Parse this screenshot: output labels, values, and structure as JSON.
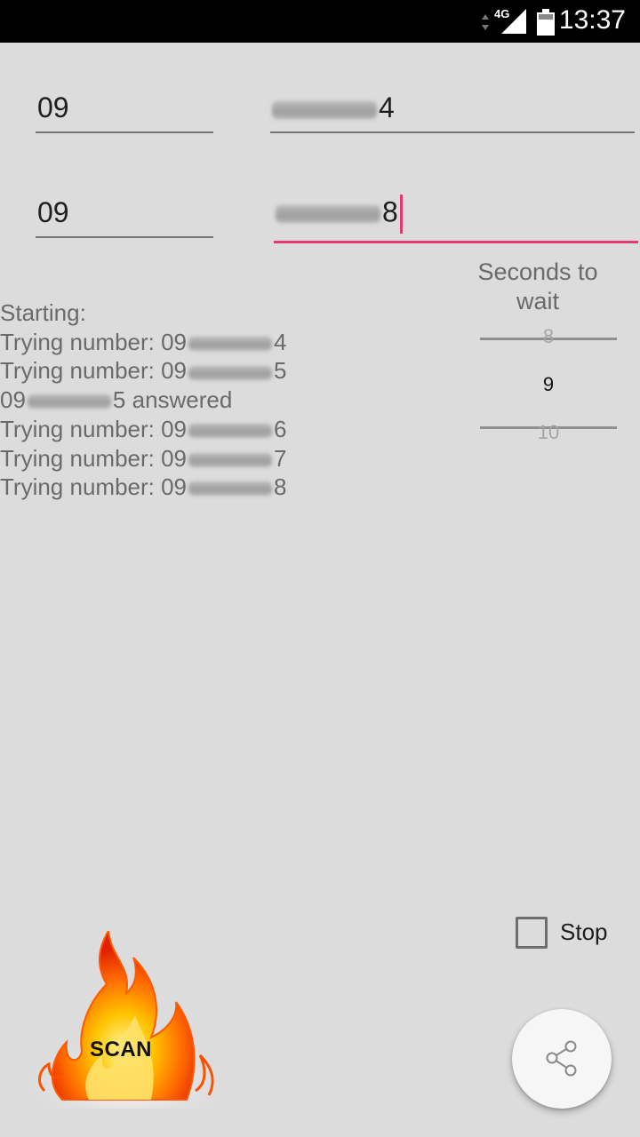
{
  "status_bar": {
    "network": "4G",
    "time": "13:37"
  },
  "form": {
    "prefix_start": "09",
    "number_start_suffix": "4",
    "prefix_end": "09",
    "number_end_suffix": "8"
  },
  "log": {
    "lines": [
      {
        "text": "Starting:",
        "redacted": false
      },
      {
        "before": "Trying number: 09",
        "after": "4",
        "redacted": true
      },
      {
        "before": "Trying number: 09",
        "after": "5",
        "redacted": true
      },
      {
        "before": "09",
        "after": "5 answered",
        "redacted": true
      },
      {
        "before": "Trying number: 09",
        "after": "6",
        "redacted": true
      },
      {
        "before": "Trying number: 09",
        "after": "7",
        "redacted": true
      },
      {
        "before": "Trying number: 09",
        "after": "8",
        "redacted": true
      }
    ]
  },
  "wait_picker": {
    "label": "Seconds to wait",
    "prev": "8",
    "current": "9",
    "next": "10"
  },
  "stop": {
    "label": "Stop",
    "checked": false
  },
  "scan_button": {
    "label": "SCAN"
  },
  "share_button": {
    "icon": "share-icon"
  },
  "colors": {
    "accent": "#e8386d",
    "background": "#dcdcdc"
  }
}
